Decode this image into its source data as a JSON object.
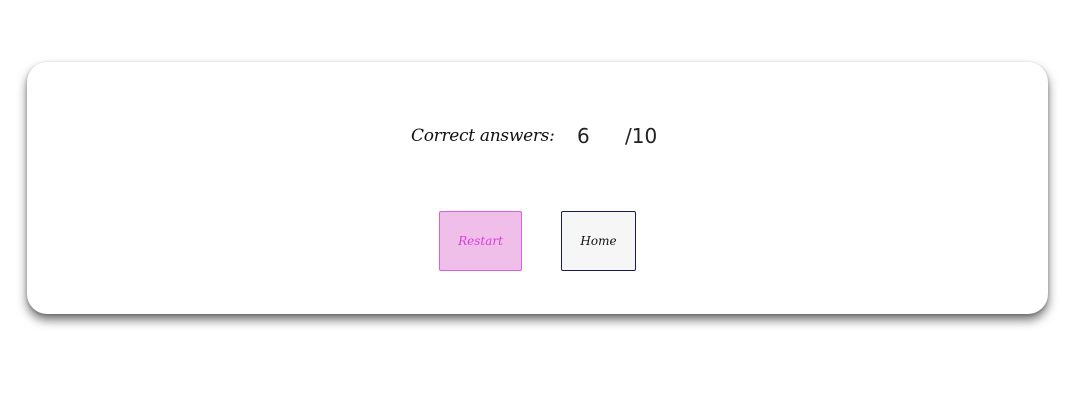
{
  "result": {
    "label": "Correct answers:",
    "correct": "6",
    "total": "/10"
  },
  "buttons": {
    "restart_label": "Restart",
    "home_label": "Home"
  },
  "colors": {
    "restart_bg": "#efbfe9",
    "restart_border": "#e05de0",
    "restart_text": "#d93fd9",
    "home_border": "#1a1a5a"
  }
}
